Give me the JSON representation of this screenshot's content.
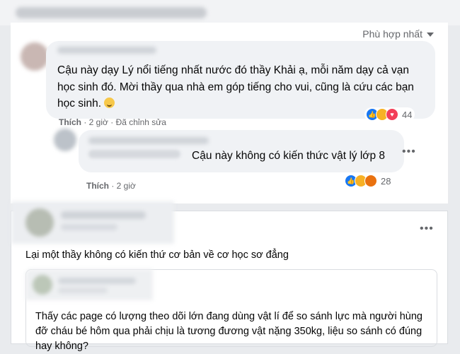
{
  "sort": {
    "label": "Phù hợp nhất"
  },
  "comment1": {
    "text": "Cậu này dạy Lý nổi tiếng nhất nước đó thầy Khải ạ, mỗi năm dạy cả vạn học sinh đó. Mời thầy qua nhà em góp tiếng cho vui, cũng là cứu các bạn học sinh.",
    "like_label": "Thích",
    "time": "2 giờ",
    "edited": "Đã chỉnh sửa",
    "reaction_count": "44"
  },
  "reply1": {
    "text": "Cậu này không có kiến thức vật lý lớp 8",
    "like_label": "Thích",
    "time": "2 giờ",
    "reaction_count": "28",
    "more": "•••"
  },
  "post": {
    "text": "Lại một thầy không có kiến thứ cơ bản về cơ học sơ đẳng",
    "more": "•••",
    "quoted_text": "Thấy các page có lượng theo dõi lớn đang dùng vật lí để so sánh lực mà người hùng đỡ cháu bé hôm qua phải chịu là tương đương vật nặng 350kg, liệu so sánh có đúng hay không?"
  },
  "colors": {
    "like": "#1877f2",
    "haha": "#f7b125",
    "angry": "#e9710f",
    "love": "#f33e58",
    "meta": "#65676b"
  }
}
